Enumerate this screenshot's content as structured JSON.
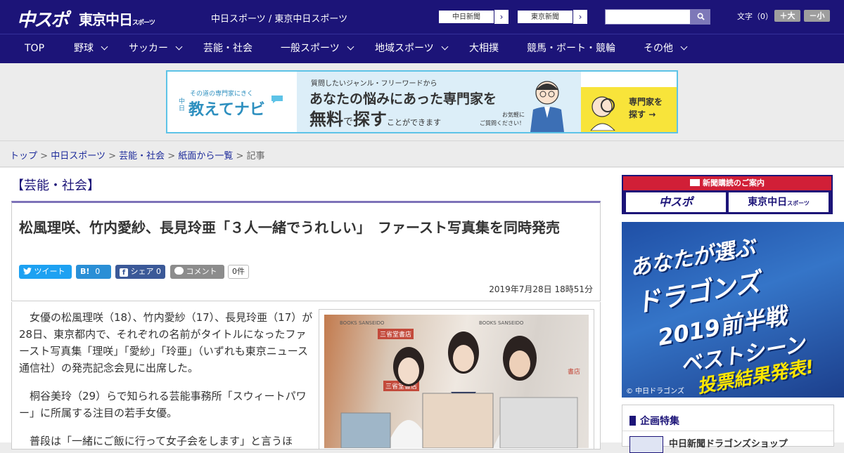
{
  "header": {
    "logo_primary": "中スポ",
    "logo_secondary": "東京中日",
    "logo_secondary_small": "スポーツ",
    "tagline": "中日スポーツ / 東京中日スポーツ",
    "paper_links": [
      "中日新聞",
      "東京新聞"
    ],
    "search_button_icon": "search-icon",
    "font_size_label": "文字（0）",
    "font_larger": "＋大",
    "font_smaller": "－小"
  },
  "nav": {
    "items": [
      {
        "label": "TOP",
        "dropdown": false
      },
      {
        "label": "野球",
        "dropdown": true
      },
      {
        "label": "サッカー",
        "dropdown": true
      },
      {
        "label": "芸能・社会",
        "dropdown": false
      },
      {
        "label": "一般スポーツ",
        "dropdown": true
      },
      {
        "label": "地域スポーツ",
        "dropdown": true
      },
      {
        "label": "大相撲",
        "dropdown": false
      },
      {
        "label": "競馬・ボート・競輪",
        "dropdown": false
      },
      {
        "label": "その他",
        "dropdown": true
      }
    ]
  },
  "top_ad": {
    "left_small": "その道の専門家にきく",
    "left_brand": "教えてナビ",
    "left_brand_prefix": "中日",
    "line1": "質問したいジャンル・フリーワードから",
    "line2": "あなたの悩みにあった専門家を",
    "line3_bold1": "無料",
    "line3_mid": "で",
    "line3_bold2": "探す",
    "line3_tail": "ことができます",
    "note1": "お気軽に",
    "note2": "ご質問ください！",
    "cta1": "専門家を",
    "cta2": "探す"
  },
  "breadcrumb": {
    "links": [
      "トップ",
      "中日スポーツ",
      "芸能・社会",
      "紙面から一覧"
    ],
    "current": "記事",
    "separator": ">"
  },
  "article": {
    "category": "【芸能・社会】",
    "title": "松風理咲、竹内愛紗、長見玲亜「３人一緒でうれしい」　ファースト写真集を同時発売",
    "share": {
      "tweet": "ツイート",
      "hatena": "B!",
      "hatena_count": "0",
      "facebook": "シェア",
      "facebook_count": "0",
      "comment": "コメント",
      "comment_count": "0件"
    },
    "date": "2019年7月28日 18時51分",
    "paragraphs": [
      "女優の松風理咲（18）、竹内愛紗（17）、長見玲亜（17）が28日、東京都内で、それぞれの名前がタイトルになったファースト写真集「理咲」「愛紗」「玲亜」（いずれも東京ニュース通信社）の発売記念会見に出席した。",
      "桐谷美玲（29）らで知られる芸能事務所「スウィートパワー」に所属する注目の若手女優。",
      "普段は「一緒にご飯に行って女子会をします」と言うほ"
    ],
    "photo_signs": [
      "BOOKS SANSEIDO",
      "三省堂書店",
      "BOOKS SANSEIDO",
      "三省堂書店",
      "書店"
    ]
  },
  "sidebar": {
    "subscribe_header": "新聞購読のご案内",
    "subscribe_left": "中スポ",
    "subscribe_right": "東京中日",
    "subscribe_right_small": "スポーツ",
    "dragons_ad": {
      "line1": "あなたが選ぶ",
      "line2": "ドラゴンズ",
      "line3": "2019前半戦",
      "line4": "ベストシーン",
      "line5": "投票結果発表!",
      "copyright": "© 中日ドラゴンズ"
    },
    "feature_title": "企画特集",
    "feature_item": "中日新聞ドラゴンズショップ"
  },
  "colors": {
    "header_bg": "#1c1478",
    "accent_red": "#d11f37",
    "twitter": "#1da1f2",
    "hatena": "#2a8fd6",
    "facebook": "#3b5998",
    "comment": "#8c8c8c"
  }
}
